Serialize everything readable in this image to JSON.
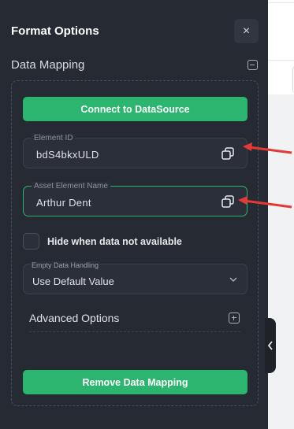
{
  "panel": {
    "title": "Format Options",
    "close_glyph": "×"
  },
  "data_mapping": {
    "title": "Data Mapping",
    "connect_button": "Connect to DataSource",
    "element_id": {
      "label": "Element ID",
      "value": "bdS4bkxULD"
    },
    "asset_element_name": {
      "label": "Asset Element Name",
      "value": "Arthur Dent"
    },
    "hide_checkbox": {
      "label": "Hide when data not available",
      "checked": false
    },
    "empty_data_handling": {
      "label": "Empty Data Handling",
      "value": "Use Default Value"
    },
    "advanced_options": {
      "title": "Advanced Options"
    },
    "remove_button": "Remove Data Mapping"
  },
  "icons": {
    "close": "close-icon",
    "collapse": "minus-square-icon",
    "expand": "plus-square-icon",
    "copy": "copy-icon",
    "dropdown": "chevron-down-icon",
    "side_tab": "chevron-left-icon",
    "annotation": "red-arrow-icon"
  },
  "colors": {
    "panel_bg": "#262a33",
    "accent_green": "#2bb56e",
    "annotation_red": "#e53935"
  }
}
